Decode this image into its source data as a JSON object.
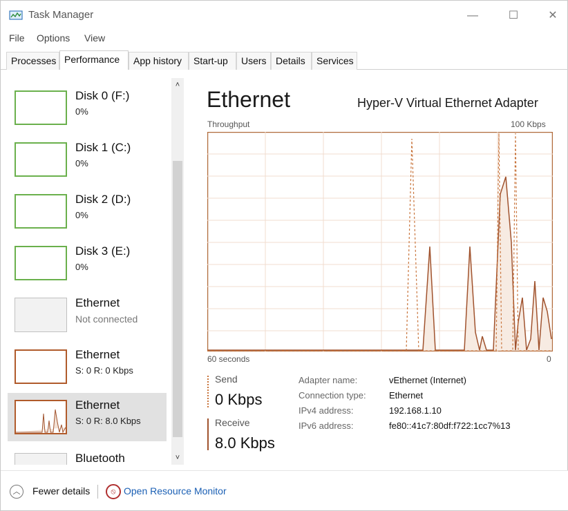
{
  "window": {
    "title": "Task Manager",
    "controls": {
      "minimize": "—",
      "maximize": "☐",
      "close": "✕"
    }
  },
  "menu": [
    "File",
    "Options",
    "View"
  ],
  "tabs": [
    "Processes",
    "Performance",
    "App history",
    "Start-up",
    "Users",
    "Details",
    "Services"
  ],
  "active_tab": "Performance",
  "sidebar": {
    "items": [
      {
        "title": "Disk 0 (F:)",
        "sub": "0%"
      },
      {
        "title": "Disk 1 (C:)",
        "sub": "0%"
      },
      {
        "title": "Disk 2 (D:)",
        "sub": "0%"
      },
      {
        "title": "Disk 3 (E:)",
        "sub": "0%"
      },
      {
        "title": "Ethernet",
        "sub": "Not connected"
      },
      {
        "title": "Ethernet",
        "sub": "S: 0 R: 0 Kbps"
      },
      {
        "title": "Ethernet",
        "sub": "S: 0 R: 8.0 Kbps"
      },
      {
        "title": "Bluetooth",
        "sub": ""
      }
    ],
    "selected_index": 6,
    "scroll_up": "˄",
    "scroll_down": "˅"
  },
  "main": {
    "title": "Ethernet",
    "adapter_full": "Hyper-V Virtual Ethernet Adapter",
    "graph": {
      "y_label": "Throughput",
      "y_max_label": "100 Kbps",
      "x_left_label": "60 seconds",
      "x_right_label": "0",
      "receive_color": "#a0522d",
      "send_color": "#c8733a"
    },
    "send": {
      "label": "Send",
      "value": "0 Kbps"
    },
    "receive": {
      "label": "Receive",
      "value": "8.0 Kbps"
    },
    "details": [
      {
        "label": "Adapter name:",
        "value": "vEthernet (Internet)"
      },
      {
        "label": "Connection type:",
        "value": "Ethernet"
      },
      {
        "label": "IPv4 address:",
        "value": "192.168.1.10"
      },
      {
        "label": "IPv6 address:",
        "value": "fe80::41c7:80df:f722:1cc7%13"
      }
    ]
  },
  "footer": {
    "fewer_details": "Fewer details",
    "open_monitor": "Open Resource Monitor"
  }
}
